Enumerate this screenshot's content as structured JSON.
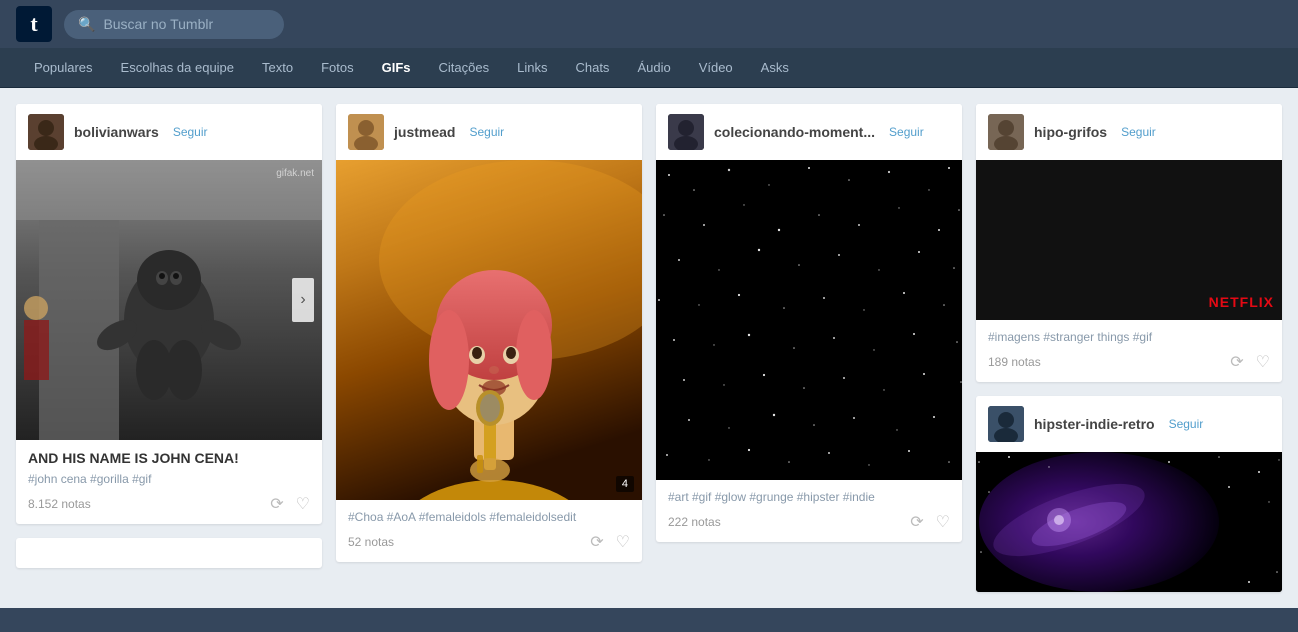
{
  "app": {
    "logo": "t",
    "search_placeholder": "Buscar no Tumblr"
  },
  "nav": {
    "items": [
      {
        "label": "Populares",
        "active": false
      },
      {
        "label": "Escolhas da equipe",
        "active": false
      },
      {
        "label": "Texto",
        "active": false
      },
      {
        "label": "Fotos",
        "active": false
      },
      {
        "label": "GIFs",
        "active": true
      },
      {
        "label": "Citações",
        "active": false
      },
      {
        "label": "Links",
        "active": false
      },
      {
        "label": "Chats",
        "active": false
      },
      {
        "label": "Áudio",
        "active": false
      },
      {
        "label": "Vídeo",
        "active": false
      },
      {
        "label": "Asks",
        "active": false
      }
    ]
  },
  "posts": [
    {
      "id": "post1",
      "blog": "bolivianwars",
      "follow_label": "Seguir",
      "title": "AND HIS NAME IS JOHN CENA!",
      "tags": "#john cena  #gorilla  #gif",
      "notes": "8.152 notas",
      "watermark": "gifak.net",
      "image_type": "gorilla"
    },
    {
      "id": "post2",
      "blog": "justmead",
      "follow_label": "Seguir",
      "tags": "#Choa  #AoA  #femaleidols  #femaleidolsedit",
      "notes": "52 notas",
      "gif_count": "4",
      "image_type": "singer"
    },
    {
      "id": "post3",
      "blog": "colecionando-moment...",
      "follow_label": "Seguir",
      "tags": "#art  #gif  #glow  #grunge  #hipster  #indie",
      "notes": "222 notas",
      "image_type": "stars"
    },
    {
      "id": "post4",
      "blog": "hipo-grifos",
      "follow_label": "Seguir",
      "tags": "#imagens  #stranger things  #gif",
      "notes": "189 notas",
      "netflix_text": "NETFLIX",
      "image_type": "netflix"
    },
    {
      "id": "post5",
      "blog": "hipster-indie-retro",
      "follow_label": "Seguir",
      "image_type": "space"
    }
  ],
  "icons": {
    "search": "🔍",
    "reblog": "⟳",
    "heart": "♡",
    "arrow_right": "›"
  }
}
